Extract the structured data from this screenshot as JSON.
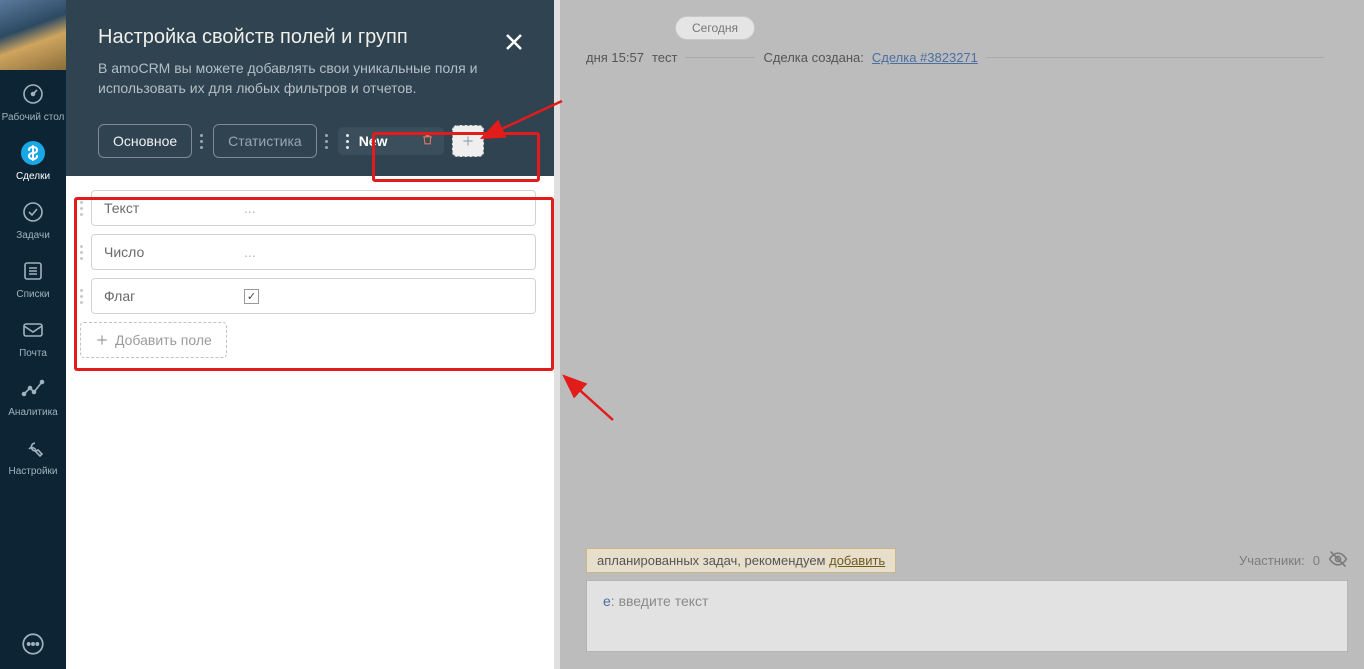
{
  "sidebar": {
    "items": [
      {
        "label": "Рабочий стол"
      },
      {
        "label": "Сделки"
      },
      {
        "label": "Задачи"
      },
      {
        "label": "Списки"
      },
      {
        "label": "Почта"
      },
      {
        "label": "Аналитика"
      },
      {
        "label": "Настройки"
      }
    ]
  },
  "background": {
    "today_label": "Сегодня",
    "feed_time": "дня 15:57",
    "feed_user": "тест",
    "feed_text": "Сделка создана:",
    "deal_link": "Сделка #3823271",
    "task_text": "апланированных задач, рекомендуем",
    "task_link": "добавить",
    "participants_label": "Участники:",
    "participants_count": "0",
    "note_link_part": "е",
    "note_placeholder": ": введите текст"
  },
  "panel": {
    "title": "Настройка свойств полей и групп",
    "description": "В amoCRM вы можете добавлять свои уникальные поля и использовать их для любых фильтров и отчетов.",
    "tabs": {
      "main": "Основное",
      "stats": "Статистика",
      "new": "New"
    },
    "fields": [
      {
        "name": "Текст",
        "value": "..."
      },
      {
        "name": "Число",
        "value": "..."
      },
      {
        "name": "Флаг",
        "value_type": "checkbox",
        "checked": true
      }
    ],
    "add_field_label": "Добавить поле"
  }
}
